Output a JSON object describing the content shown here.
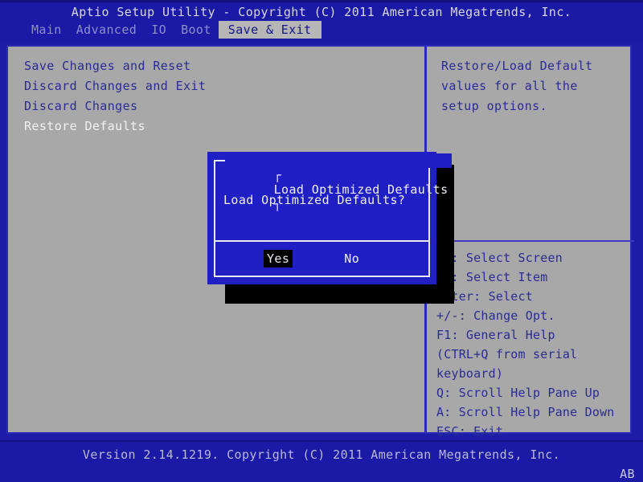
{
  "header": {
    "title": "Aptio Setup Utility - Copyright (C) 2011 American Megatrends, Inc.",
    "tabs": [
      {
        "label": "Main",
        "active": false
      },
      {
        "label": "Advanced",
        "active": false
      },
      {
        "label": "IO",
        "active": false
      },
      {
        "label": "Boot",
        "active": false
      },
      {
        "label": "Save & Exit",
        "active": true
      }
    ]
  },
  "menu": {
    "items": [
      {
        "label": "Save Changes and Reset",
        "selected": false
      },
      {
        "label": "Discard Changes and Exit",
        "selected": false
      },
      {
        "label": "Discard Changes",
        "selected": false
      },
      {
        "label": "Restore Defaults",
        "selected": true
      }
    ]
  },
  "help": {
    "description": [
      "Restore/Load Default",
      "values for all the",
      "setup options."
    ],
    "keys": [
      "><: Select Screen",
      "^v: Select Item",
      "Enter: Select",
      "+/-: Change Opt.",
      "F1: General Help",
      "(CTRL+Q from serial",
      "keyboard)",
      "Q: Scroll Help Pane Up",
      "A: Scroll Help Pane Down",
      "ESC: Exit"
    ]
  },
  "dialog": {
    "title": "Load Optimized Defaults",
    "title_bracket_left": "┌",
    "title_bracket_right": "┐",
    "message": "Load Optimized Defaults?",
    "buttons": [
      {
        "label": "Yes",
        "selected": true
      },
      {
        "label": "No",
        "selected": false
      }
    ]
  },
  "footer": {
    "version": "Version 2.14.1219. Copyright (C) 2011 American Megatrends, Inc.",
    "corner_code": "AB"
  },
  "colors": {
    "background_blue": "#1c1ca8",
    "panel_gray": "#a8a8a8",
    "border_blue": "#2a2ab4",
    "dialog_blue": "#1f1fc4",
    "text_blue": "#2b2b96",
    "text_white": "#f0f0f8",
    "tab_active_bg": "#b6b6b6",
    "shadow_black": "#000000"
  }
}
